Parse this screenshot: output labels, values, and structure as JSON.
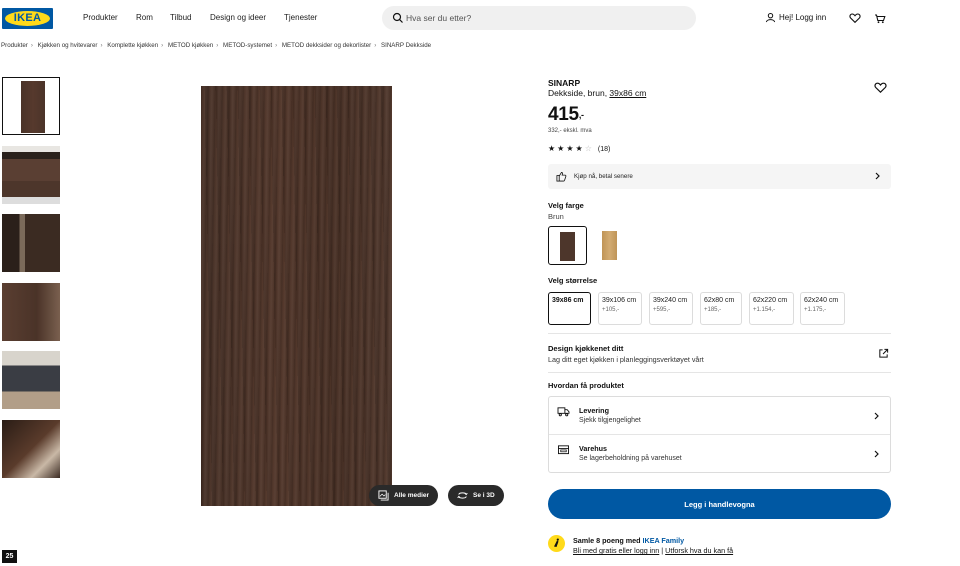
{
  "header": {
    "logo": "IKEA",
    "nav": [
      "Produkter",
      "Rom",
      "Tilbud",
      "Design og ideer",
      "Tjenester"
    ],
    "search_placeholder": "Hva ser du etter?",
    "login": "Hej! Logg inn"
  },
  "breadcrumb": [
    "Produkter",
    "Kjøkken og hvitevarer",
    "Komplette kjøkken",
    "METOD kjøkken",
    "METOD-systemet",
    "METOD dekksider og dekorlister",
    "SINARP Dekkside"
  ],
  "product": {
    "name": "SINARP",
    "desc_prefix": "Dekkside, brun, ",
    "desc_size": "39x86 cm",
    "price": "415",
    "price_suffix": ",-",
    "price_ex": "332,- ekskl. mva",
    "rating": 4,
    "reviews": "(18)"
  },
  "buttons": {
    "all_media": "Alle medier",
    "see_3d": "Se i 3D"
  },
  "klarna": "Kjøp nå, betal senere",
  "color": {
    "label": "Velg farge",
    "selected": "Brun",
    "swatches": [
      "#4d362b",
      "#c9a064"
    ]
  },
  "size": {
    "label": "Velg størrelse",
    "options": [
      {
        "size": "39x86 cm",
        "extra": ""
      },
      {
        "size": "39x106 cm",
        "extra": "+105,-"
      },
      {
        "size": "39x240 cm",
        "extra": "+595,-"
      },
      {
        "size": "62x80 cm",
        "extra": "+185,-"
      },
      {
        "size": "62x220 cm",
        "extra": "+1.154,-"
      },
      {
        "size": "62x240 cm",
        "extra": "+1.175,-"
      }
    ]
  },
  "design": {
    "title": "Design kjøkkenet ditt",
    "sub": "Lag ditt eget kjøkken i planleggingsverktøyet vårt"
  },
  "delivery": {
    "title": "Hvordan få produktet",
    "rows": [
      {
        "title": "Levering",
        "sub": "Sjekk tilgjengelighet"
      },
      {
        "title": "Varehus",
        "sub": "Se lagerbeholdning på varehuset"
      }
    ]
  },
  "cart": "Legg i handlevogna",
  "family": {
    "line1_prefix": "Samle 8 poeng med ",
    "line1_link": "IKEA Family",
    "link1": "Bli med gratis eller logg inn",
    "sep": " | ",
    "link2": "Utforsk hva du kan få"
  },
  "badge": "25",
  "colors": {
    "brand_blue": "#0058a3",
    "brand_yellow": "#ffda1a"
  }
}
